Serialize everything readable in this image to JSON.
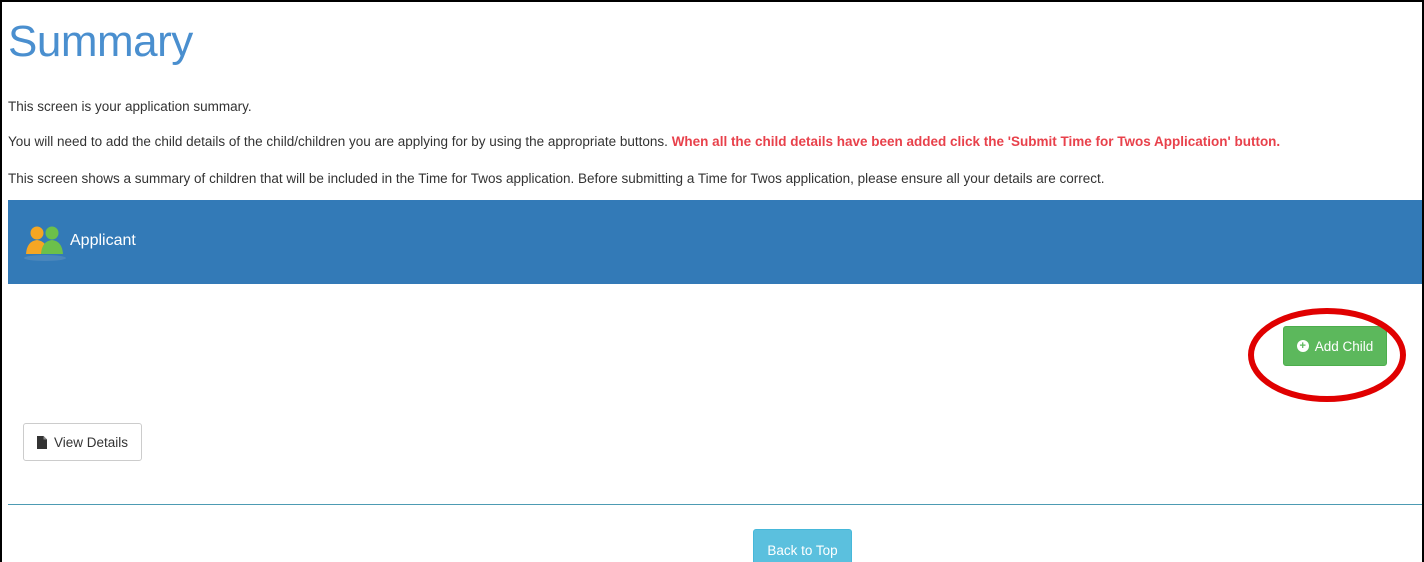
{
  "page": {
    "title": "Summary",
    "intro": "This screen is your application summary.",
    "instructions": "You will need to add the child details of the child/children you are applying for by using the appropriate buttons. ",
    "instructions_highlight": "When all the child details have been added click the 'Submit Time for Twos Application' button.",
    "summary_note": "This screen shows a summary of children that will be included in the Time for Twos application. Before submitting a Time for Twos application, please ensure all your details are correct."
  },
  "panel": {
    "title": "Applicant",
    "icon": "applicants-icon",
    "header_color": "#337ab7"
  },
  "actions": {
    "add_child_label": "Add Child",
    "add_child_icon": "plus-circle-icon",
    "view_details_label": "View Details",
    "view_details_icon": "document-icon",
    "back_to_top_label": "Back to Top"
  },
  "colors": {
    "title": "#4a8fcf",
    "warning_text": "#e8414b",
    "add_button": "#5cb85c",
    "back_to_top_button": "#5bc0de",
    "highlight_annotation": "#e00000"
  }
}
